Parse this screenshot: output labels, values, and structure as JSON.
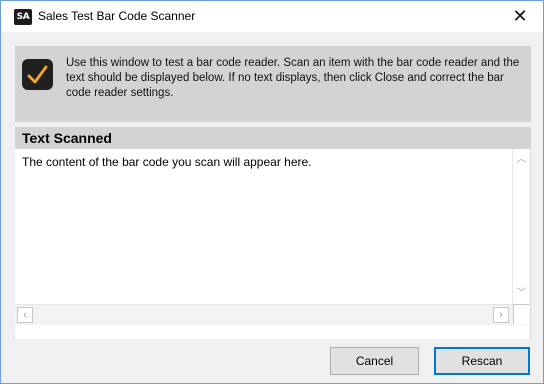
{
  "window": {
    "title": "Sales Test Bar Code Scanner",
    "app_icon_text": "SA",
    "close_glyph": "✕"
  },
  "info": {
    "icon": "checkmark-icon",
    "text": "Use this window to test a bar code reader.  Scan an item with the bar code reader and the text should be displayed below.  If no text displays, then click Close and correct the bar code reader settings."
  },
  "section": {
    "title": "Text Scanned"
  },
  "scan_area": {
    "text": "The content of the bar code you scan will appear here."
  },
  "buttons": {
    "cancel": "Cancel",
    "rescan": "Rescan"
  },
  "colors": {
    "accent": "#0078d7",
    "check": "#f5a623",
    "panel": "#d3d3d3"
  }
}
